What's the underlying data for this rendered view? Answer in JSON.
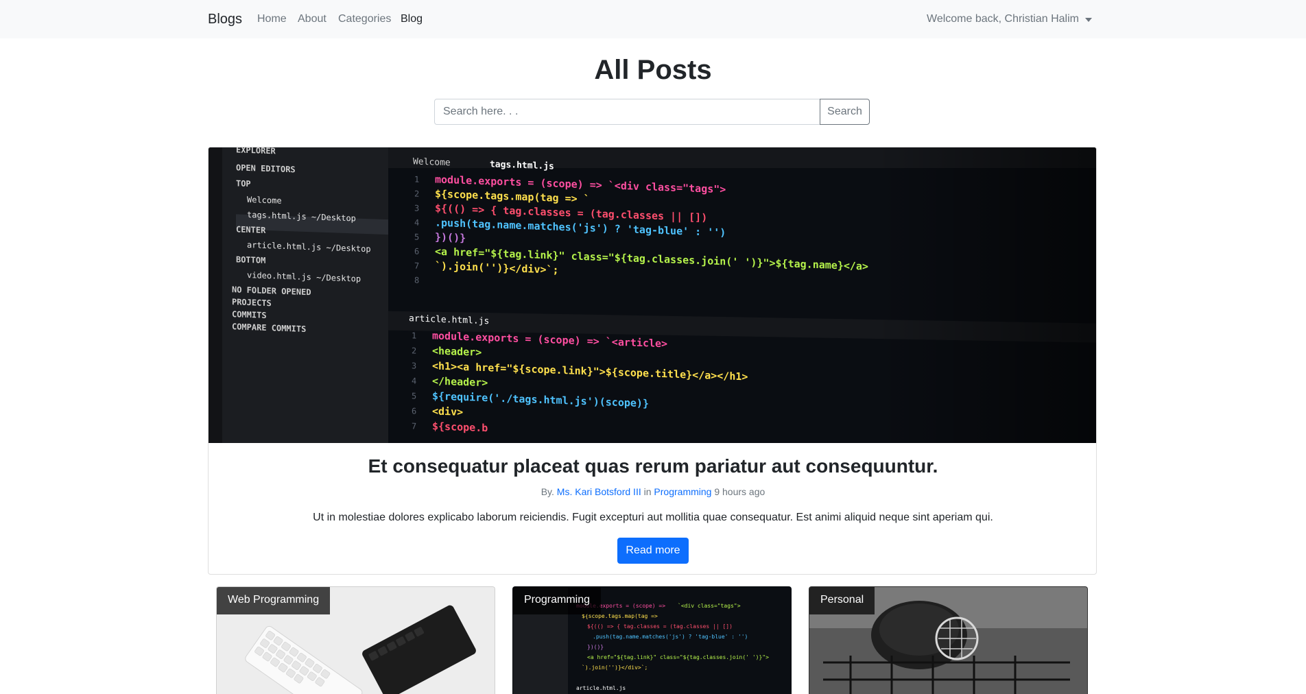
{
  "navbar": {
    "brand": "Blogs",
    "links": [
      "Home",
      "About",
      "Categories",
      "Blog"
    ],
    "user": "Welcome back, Christian Halim"
  },
  "page": {
    "title": "All Posts"
  },
  "search": {
    "placeholder": "Search here. . .",
    "button": "Search"
  },
  "featured": {
    "image": {
      "explorer": [
        "EXPLORER",
        "OPEN EDITORS",
        "TOP",
        "Welcome",
        "tags.html.js ~/Desktop",
        "CENTER",
        "article.html.js ~/Desktop",
        "BOTTOM",
        "video.html.js ~/Desktop",
        "NO FOLDER OPENED",
        "PROJECTS",
        "COMMITS",
        "COMPARE COMMITS"
      ],
      "tabs": [
        "Welcome",
        "tags.html.js"
      ],
      "code_top": [
        "module.exports = (scope) => `<div class=\"tags\">",
        "  ${scope.tags.map(tag => `",
        "    ${(() => { tag.classes = (tag.classes || [])",
        "      .push(tag.name.matches('js') ? 'tag-blue' : '')",
        "    })()}",
        "    <a href=\"${tag.link}\" class=\"${tag.classes.join(' ')}\">${tag.name}</a>",
        "`).join('')}</div>`;",
        ""
      ],
      "tab2": "article.html.js",
      "code_bottom": [
        "module.exports = (scope) => `<article>",
        "  <header>",
        "    <h1><a href=\"${scope.link}\">${scope.title}</a></h1>",
        "  </header>",
        "  ${require('./tags.html.js')(scope)}",
        "  <div>",
        "    ${scope.b"
      ]
    },
    "title": "Et consequatur placeat quas rerum pariatur aut consequuntur.",
    "meta_prefix": "By.",
    "author": "Ms. Kari Botsford III",
    "meta_in": "in",
    "category": "Programming",
    "time": "9 hours ago",
    "excerpt": "Ut in molestiae dolores explicabo laborum reiciendis. Fugit excepturi aut mollitia quae consequatur. Est animi aliquid neque sint aperiam qui.",
    "button": "Read more"
  },
  "cards": [
    {
      "category": "Web Programming"
    },
    {
      "category": "Programming"
    },
    {
      "category": "Personal"
    }
  ],
  "colors": {
    "primary": "#0d6efd",
    "navbar_bg": "#f8f9fa",
    "muted": "#6c757d"
  }
}
